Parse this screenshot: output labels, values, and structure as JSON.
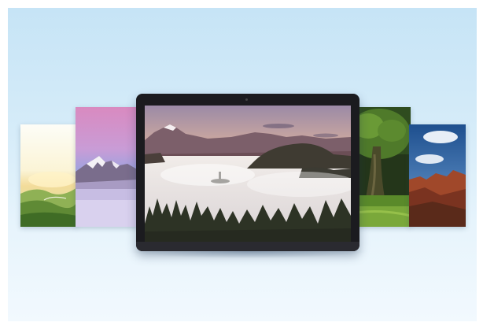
{
  "scene": {
    "cards": [
      {
        "name": "sunrise-hills-wallpaper"
      },
      {
        "name": "pink-snow-mountain-wallpaper"
      },
      {
        "name": "foggy-valley-wallpaper"
      },
      {
        "name": "green-tree-wallpaper"
      },
      {
        "name": "red-canyon-wallpaper"
      }
    ],
    "colors": {
      "background_top": "#c6e4f6",
      "background_bottom": "#f2f9fe",
      "laptop_body": "#1b1b1f"
    }
  }
}
